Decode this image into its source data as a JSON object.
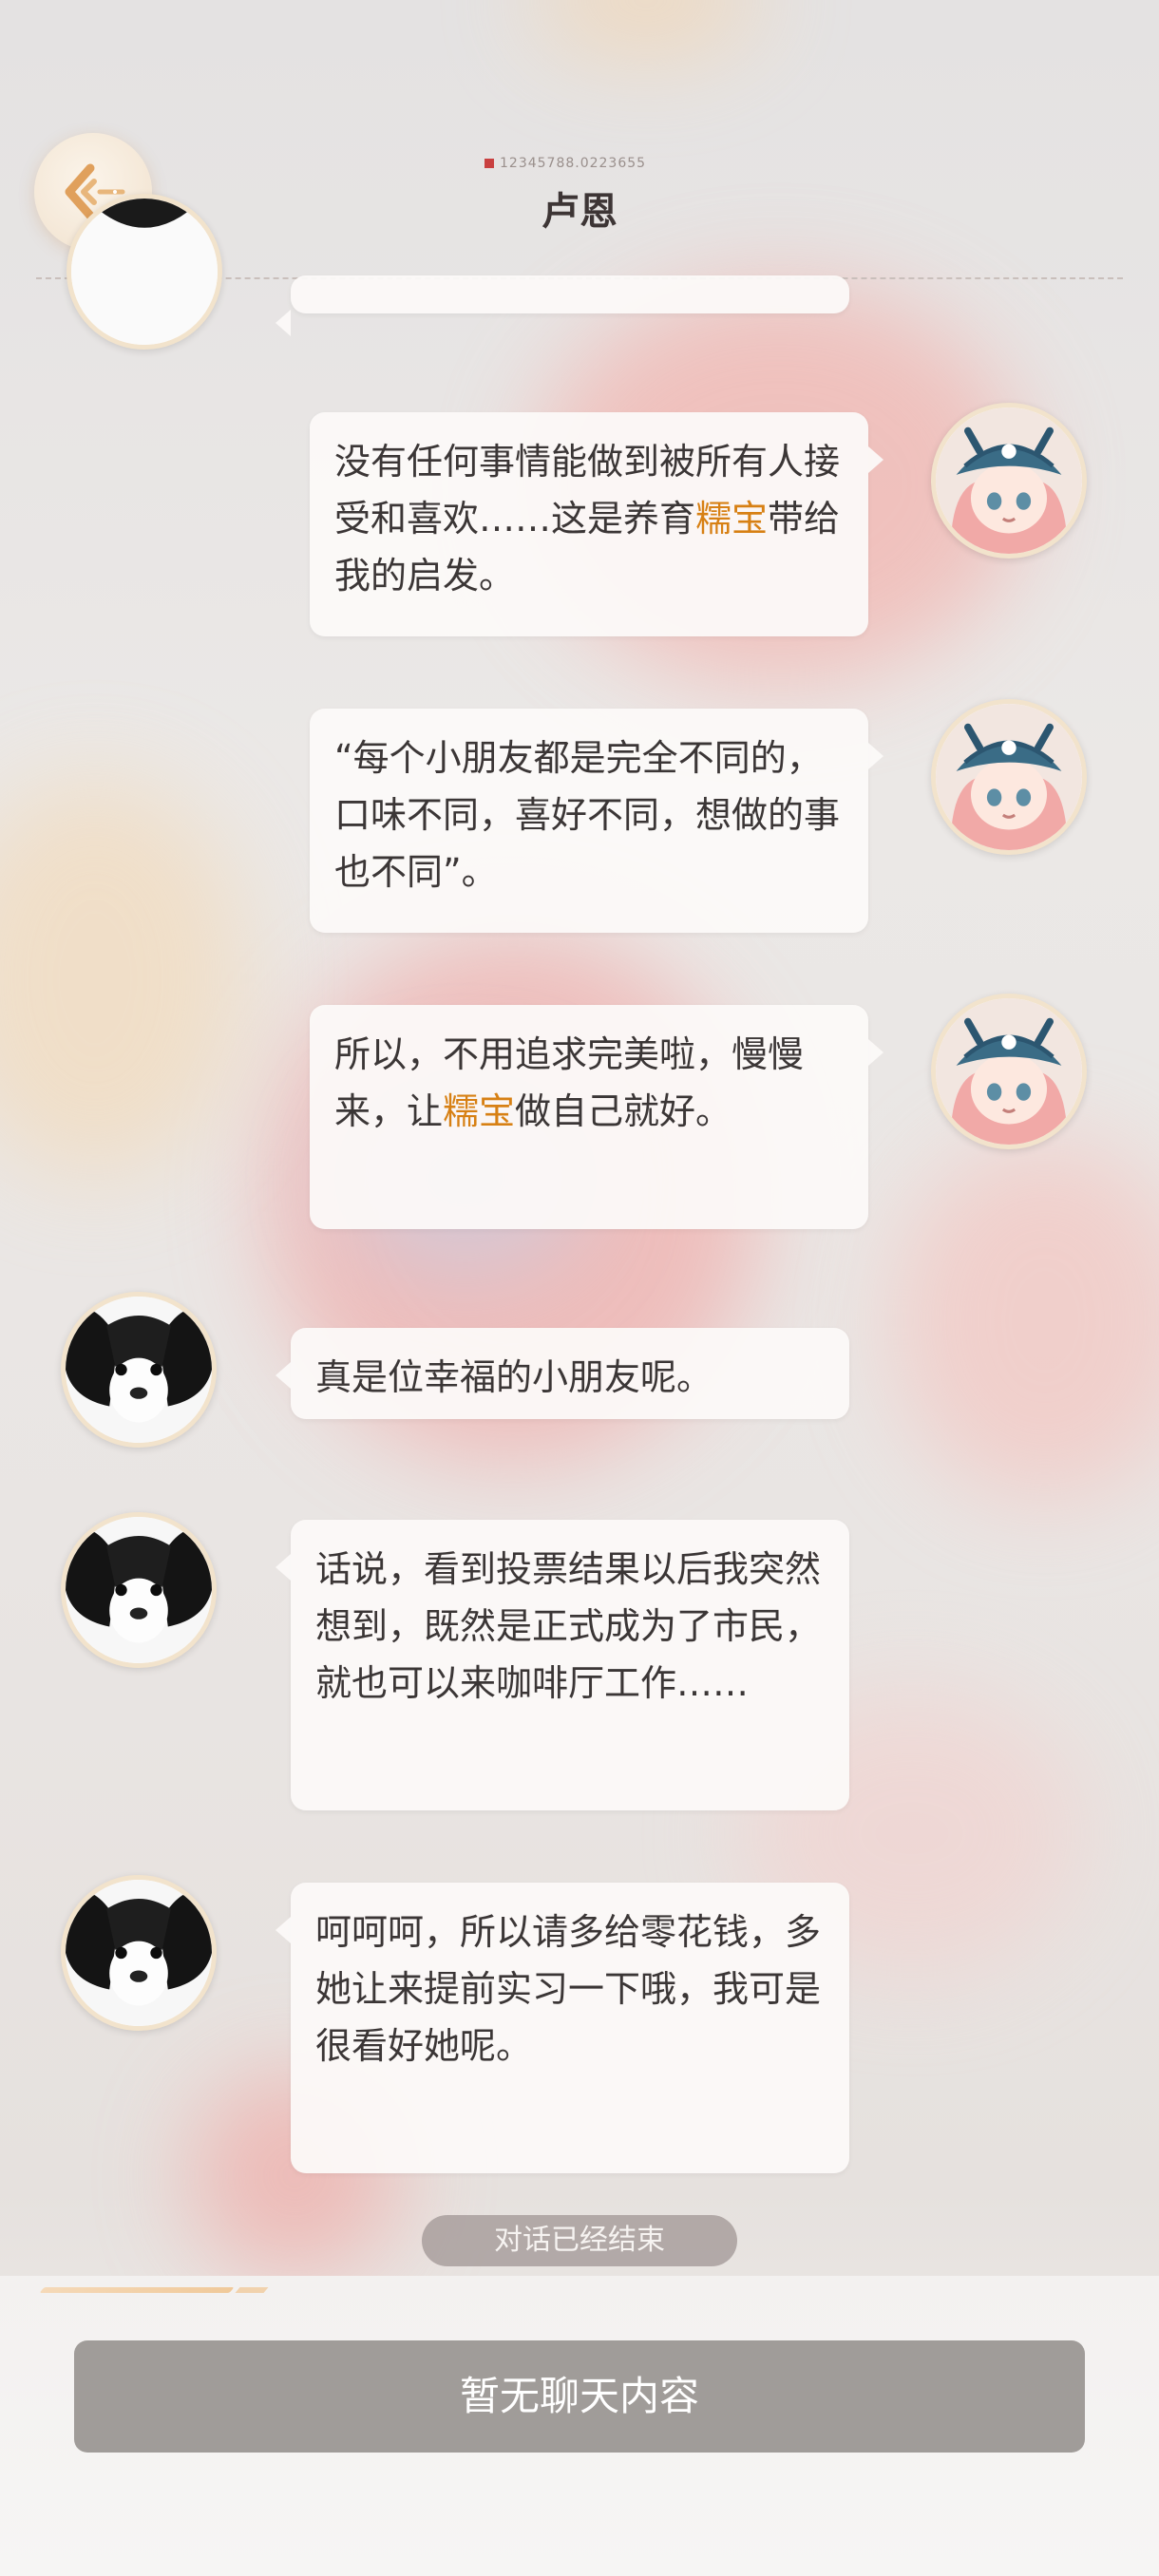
{
  "header": {
    "id_text": "12345788.0223655",
    "title": "卢恩"
  },
  "messages": [
    {
      "sender": "right",
      "segments": [
        {
          "text": "没有任何事情能做到被所有人接受和喜欢……这是养育"
        },
        {
          "text": "糯宝",
          "highlight": true
        },
        {
          "text": "带给我的启发。"
        }
      ]
    },
    {
      "sender": "right",
      "segments": [
        {
          "text": "“每个小朋友都是完全不同的，口味不同，喜好不同，想做的事也不同”。"
        }
      ]
    },
    {
      "sender": "right",
      "segments": [
        {
          "text": "所以，不用追求完美啦，慢慢来，让"
        },
        {
          "text": "糯宝",
          "highlight": true
        },
        {
          "text": "做自己就好。"
        }
      ]
    },
    {
      "sender": "left",
      "segments": [
        {
          "text": "真是位幸福的小朋友呢。"
        }
      ]
    },
    {
      "sender": "left",
      "segments": [
        {
          "text": "话说，看到投票结果以后我突然想到，既然是正式成为了市民，就也可以来咖啡厅工作……"
        }
      ]
    },
    {
      "sender": "left",
      "segments": [
        {
          "text": "呵呵呵，所以请多给零花钱，多她让来提前实习一下哦，我可是很看好她呢。"
        }
      ]
    }
  ],
  "status": {
    "ended": "对话已经结束"
  },
  "footer": {
    "button_label": "暂无聊天内容"
  },
  "colors": {
    "highlight": "#d78014",
    "button": "#a09c99",
    "avatar_border": "#f2e3cc"
  },
  "icons": {
    "back": "back-arrow-icon",
    "girl_avatar": "girl-with-cap-avatar",
    "dog_avatar": "puppy-avatar"
  }
}
